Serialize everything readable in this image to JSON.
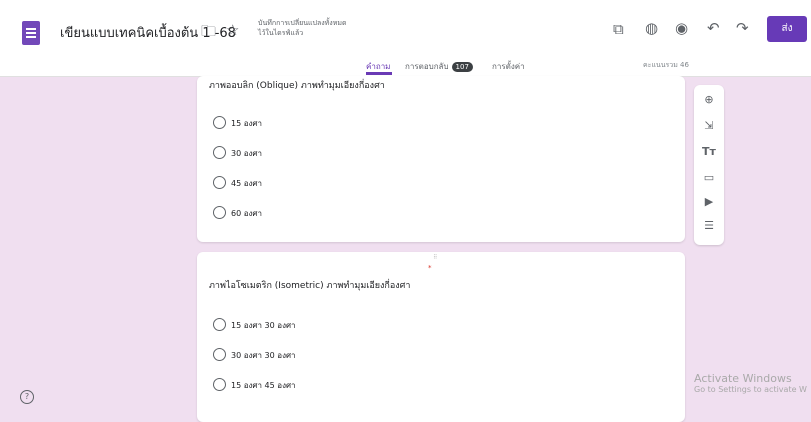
{
  "header": {
    "form_title": "เขียนแบบเทคนิคเบื้องต้น 1 -68",
    "save_status_line1": "บันทึกการเปลี่ยนแปลงทั้งหมด",
    "save_status_line2": "ไว้ในไดรฟ์แล้ว",
    "send_label": "ส่ง",
    "icons": [
      "forms-app-icon",
      "folder-icon",
      "star-icon",
      "addon-icon",
      "palette-icon",
      "preview-eye-icon",
      "undo-icon",
      "redo-icon"
    ]
  },
  "tabs": [
    {
      "label": "คำถาม",
      "active": true
    },
    {
      "label": "การตอบกลับ",
      "badge": "107"
    },
    {
      "label": "การตั้งค่า"
    }
  ],
  "total_points": "คะแนนรวม 46",
  "questions": [
    {
      "title": "ภาพออบลิก (Oblique) ภาพทำมุมเอียงกี่องศา",
      "options": [
        "15 องศา",
        "30 องศา",
        "45 องศา",
        "60 องศา"
      ]
    },
    {
      "title": "ภาพไอโซเมตริก (Isometric) ภาพทำมุมเอียงกี่องศา",
      "required_mark": "*",
      "drag_handle": "⠿",
      "options": [
        "15 องศา 30 องศา",
        "30 องศา 30 องศา",
        "15 องศา 45 องศา"
      ]
    }
  ],
  "toolbar": [
    "add-question-icon",
    "import-questions-icon",
    "add-title-icon",
    "add-image-icon",
    "add-video-icon",
    "add-section-icon"
  ],
  "help_label": "?",
  "watermark": {
    "line1": "Activate Windows",
    "line2": "Go to Settings to activate W"
  }
}
